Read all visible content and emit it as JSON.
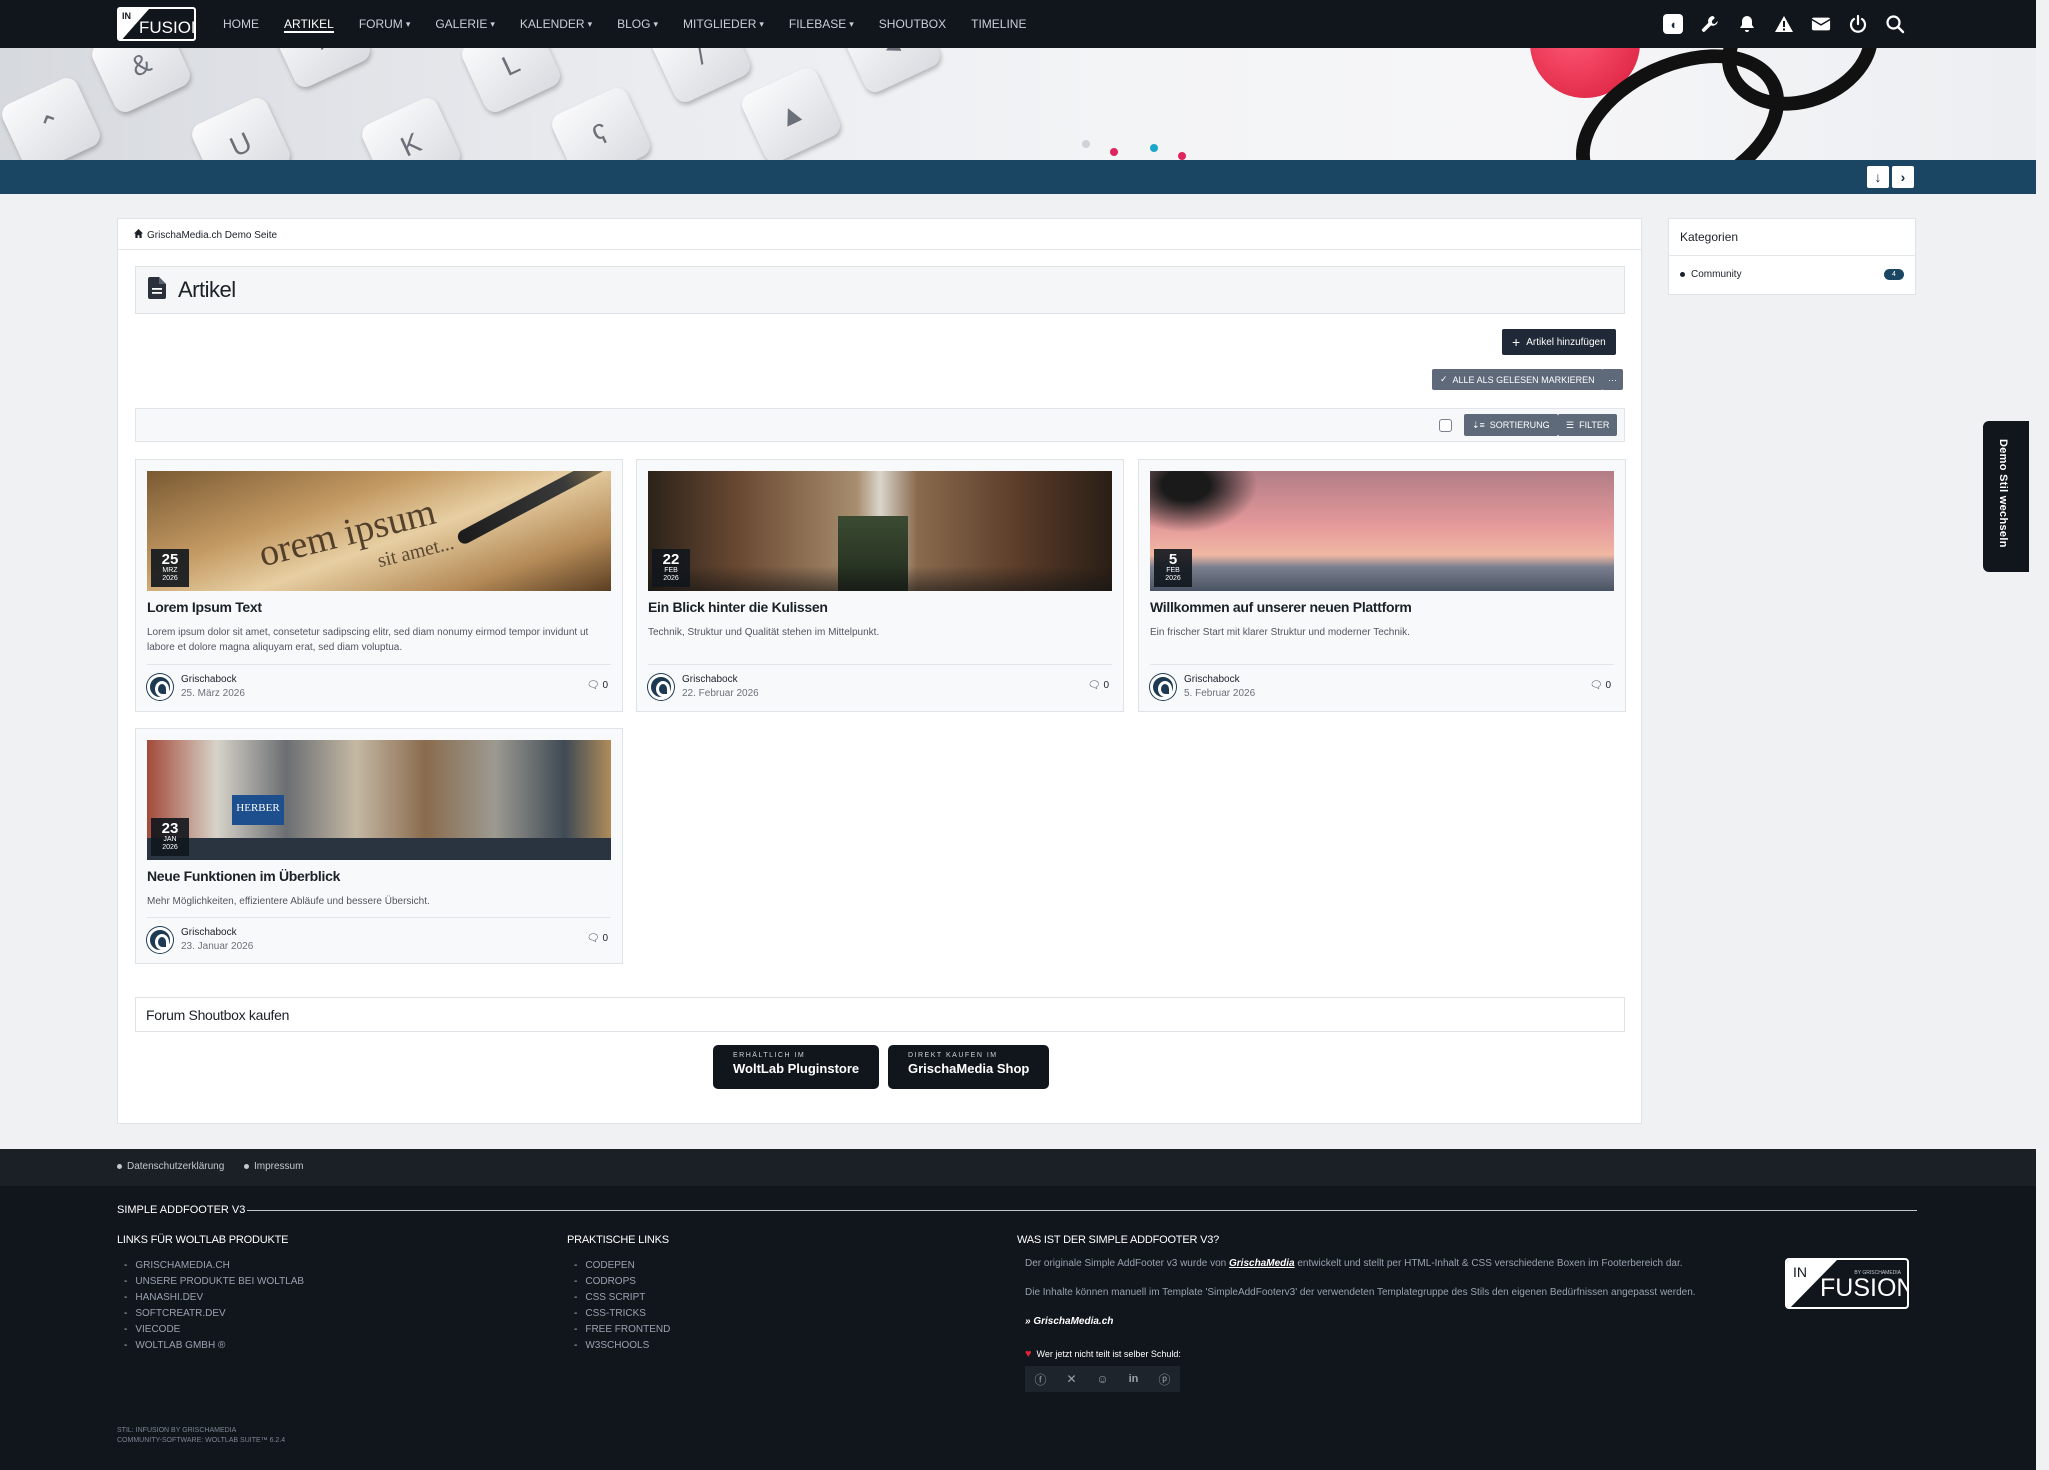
{
  "nav": {
    "logo_in": "IN",
    "logo_fusion": "FUSION",
    "items": [
      {
        "label": "HOME",
        "dropdown": false
      },
      {
        "label": "ARTIKEL",
        "dropdown": false,
        "active": true
      },
      {
        "label": "FORUM",
        "dropdown": true
      },
      {
        "label": "GALERIE",
        "dropdown": true
      },
      {
        "label": "KALENDER",
        "dropdown": true
      },
      {
        "label": "BLOG",
        "dropdown": true
      },
      {
        "label": "MITGLIEDER",
        "dropdown": true
      },
      {
        "label": "FILEBASE",
        "dropdown": true
      },
      {
        "label": "SHOUTBOX",
        "dropdown": false
      },
      {
        "label": "TIMELINE",
        "dropdown": false
      }
    ],
    "icons": [
      "user-avatar-icon",
      "wrench-icon",
      "bell-icon",
      "warning-icon",
      "envelope-icon",
      "power-icon",
      "search-icon"
    ]
  },
  "breadcrumb": "GrischaMedia.ch Demo Seite",
  "page": {
    "title": "Artikel",
    "add_button": "Artikel hinzufügen",
    "mark_read_button": "ALLE ALS GELESEN MARKIEREN",
    "sort_button": "SORTIERUNG",
    "filter_button": "FILTER"
  },
  "articles": [
    {
      "day": "25",
      "month": "MRZ",
      "year": "2026",
      "title": "Lorem Ipsum Text",
      "teaser": "Lorem ipsum dolor sit amet, consetetur sadipscing elitr, sed diam nonumy eirmod tempor invidunt ut labore et dolore magna aliquyam erat, sed diam voluptua.",
      "author": "Grischabock",
      "date": "25. März 2026",
      "comments": "0"
    },
    {
      "day": "22",
      "month": "FEB",
      "year": "2026",
      "title": "Ein Blick hinter die Kulissen",
      "teaser": "Technik, Struktur und Qualität stehen im Mittelpunkt.",
      "author": "Grischabock",
      "date": "22. Februar 2026",
      "comments": "0"
    },
    {
      "day": "5",
      "month": "FEB",
      "year": "2026",
      "title": "Willkommen auf unserer neuen Plattform",
      "teaser": "Ein frischer Start mit klarer Struktur und moderner Technik.",
      "author": "Grischabock",
      "date": "5. Februar 2026",
      "comments": "0"
    },
    {
      "day": "23",
      "month": "JAN",
      "year": "2026",
      "title": "Neue Funktionen im Überblick",
      "teaser": "Mehr Möglichkeiten, effizientere Abläufe und bessere Übersicht.",
      "author": "Grischabock",
      "date": "23. Januar 2026",
      "comments": "0"
    }
  ],
  "image_text": {
    "lorem": "orem ipsum",
    "sit": "sit amet...",
    "herber": "HERBER"
  },
  "shoutbox": {
    "title": "Forum Shoutbox kaufen",
    "btn1_small": "ERHÄLTLICH IM",
    "btn1_big": "WoltLab Pluginstore",
    "btn2_small": "DIREKT KAUFEN IM",
    "btn2_big": "GrischaMedia Shop"
  },
  "sidebar": {
    "title": "Kategorien",
    "items": [
      {
        "label": "Community",
        "count": "4"
      }
    ]
  },
  "demo_tab": "Demo Stil wechseln",
  "footer": {
    "links_top": [
      "Datenschutzerklärung",
      "Impressum"
    ],
    "heading": "SIMPLE ADDFOOTER V3",
    "col1_title": "LINKS FÜR WOLTLAB PRODUKTE",
    "col1": [
      "GRISCHAMEDIA.CH",
      "UNSERE PRODUKTE BEI WOLTLAB",
      "HANASHI.DEV",
      "SOFTCREATR.DEV",
      "VIECODE",
      "WOLTLAB GMBH ®"
    ],
    "col2_title": "PRAKTISCHE LINKS",
    "col2": [
      "CODEPEN",
      "CODROPS",
      "CSS SCRIPT",
      "CSS-TRICKS",
      "FREE FRONTEND",
      "W3SCHOOLS"
    ],
    "col3_title": "WAS IST DER SIMPLE ADDFOOTER V3?",
    "p1_a": "Der originale Simple AddFooter v3 wurde von ",
    "p1_b": "GrischaMedia",
    "p1_c": " entwickelt und stellt per HTML-Inhalt & CSS verschiedene Boxen im Footerbereich dar.",
    "p2": "Die Inhalte können manuell im Template 'SimpleAddFooterv3' der verwendeten Templategruppe des Stils den eigenen Bedürfnissen angepasst werden.",
    "grischa_link": "» GrischaMedia.ch",
    "heart_text": "Wer jetzt nicht teilt ist selber Schuld:",
    "social": [
      "facebook-icon",
      "x-icon",
      "reddit-icon",
      "linkedin-icon",
      "pinterest-icon"
    ],
    "logo_in": "IN",
    "logo_fusion": "FUSION",
    "logo_by": "BY GRISCHAMEDIA",
    "copy1": "STIL: INFUSION BY GRISCHAMEDIA",
    "copy2": "COMMUNITY-SOFTWARE: WOLTLAB SUITE™ 6.2.4"
  }
}
